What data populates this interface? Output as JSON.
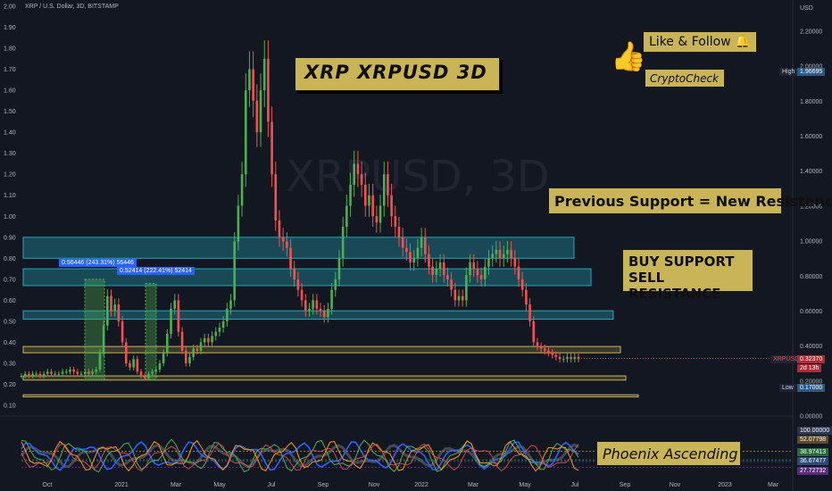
{
  "header": {
    "symbol_text": "XRP / U.S. Dollar, 3D, BITSTAMP"
  },
  "watermark": {
    "text": "XRPUSD, 3D",
    "subtext": "XRP / U.S. Dollar"
  },
  "annotations": {
    "title": "XRP   XRPUSD   3D",
    "like_follow": "Like & Follow 🔔",
    "cryptocheck": "CryptoCheck",
    "previous_support": "Previous Support = New Resistance",
    "buy_support": "BUY SUPPORT",
    "sell_resistance": "SELL RESISTANCE",
    "phoenix": "Phoenix Ascending"
  },
  "measure_labels": [
    "0.56446 (243.31%) 56446",
    "0.52414 (222.41%) 52414"
  ],
  "price_tags": {
    "high_label": "High",
    "high_value": "1.96695",
    "symbol": "XRPUSD",
    "last_value": "0.32370",
    "countdown": "2d 13h",
    "low_label": "Low",
    "low_value": "0.17000"
  },
  "osc_tags": [
    "100.00000",
    "52.07798",
    "38.97413",
    "36.67477",
    "27.72732"
  ],
  "colors": {
    "background": "#131722",
    "up": "#26a69a",
    "down": "#ef5350",
    "up_bright": "#4caf50",
    "zone_blue": "#26a6b8",
    "zone_gold": "#c9b458",
    "annotation_bg": "#c9b458"
  },
  "chart_data": {
    "type": "candlestick",
    "title": "XRP / U.S. Dollar, 3D, BITSTAMP",
    "x_tick_labels": [
      "Oct",
      "2021",
      "Mar",
      "May",
      "Jul",
      "Sep",
      "Nov",
      "2022",
      "Mar",
      "May",
      "Jul",
      "Sep",
      "Nov",
      "2023",
      "Mar"
    ],
    "left_axis_ticks": [
      "2.00",
      "1.90",
      "1.80",
      "1.70",
      "1.60",
      "1.50",
      "1.40",
      "1.30",
      "1.20",
      "1.10",
      "1.00",
      "0.90",
      "0.80",
      "0.70",
      "0.60",
      "0.50",
      "0.40",
      "0.30",
      "0.20",
      "0.10"
    ],
    "right_axis_unit": "USD",
    "right_axis_ticks": [
      "2.20000",
      "2.00000",
      "1.80000",
      "1.60000",
      "1.40000",
      "1.20000",
      "1.00000",
      "0.80000",
      "0.60000",
      "0.40000",
      "0.20000",
      "0.00000"
    ],
    "ylim": [
      0.1,
      2.0
    ],
    "high": 1.96695,
    "low": 0.17,
    "last": 0.3237,
    "blue_zones": [
      [
        0.8,
        0.9
      ],
      [
        0.67,
        0.75
      ],
      [
        0.51,
        0.55
      ]
    ],
    "gold_zones": [
      [
        0.35,
        0.38
      ],
      [
        0.22,
        0.24
      ],
      [
        0.14,
        0.15
      ]
    ],
    "series": [
      {
        "name": "XRPUSD",
        "close": [
          0.24,
          0.25,
          0.24,
          0.25,
          0.25,
          0.24,
          0.25,
          0.26,
          0.25,
          0.25,
          0.25,
          0.26,
          0.26,
          0.27,
          0.26,
          0.25,
          0.25,
          0.26,
          0.25,
          0.26,
          0.27,
          0.35,
          0.48,
          0.62,
          0.55,
          0.58,
          0.5,
          0.4,
          0.3,
          0.28,
          0.32,
          0.26,
          0.24,
          0.23,
          0.25,
          0.26,
          0.27,
          0.3,
          0.35,
          0.44,
          0.56,
          0.6,
          0.45,
          0.36,
          0.3,
          0.33,
          0.37,
          0.36,
          0.4,
          0.42,
          0.4,
          0.43,
          0.45,
          0.47,
          0.5,
          0.56,
          0.6,
          0.88,
          1.05,
          1.2,
          1.6,
          1.7,
          1.55,
          1.4,
          1.6,
          1.75,
          1.45,
          1.2,
          0.98,
          0.9,
          0.88,
          0.85,
          0.75,
          0.7,
          0.65,
          0.6,
          0.55,
          0.56,
          0.6,
          0.56,
          0.55,
          0.52,
          0.56,
          0.65,
          0.7,
          0.8,
          0.95,
          1.05,
          1.15,
          1.25,
          1.2,
          1.15,
          1.05,
          1.1,
          1.0,
          0.97,
          1.05,
          1.2,
          1.1,
          1.0,
          0.95,
          0.9,
          0.85,
          0.83,
          0.78,
          0.8,
          0.85,
          0.9,
          0.82,
          0.76,
          0.72,
          0.75,
          0.78,
          0.72,
          0.7,
          0.65,
          0.6,
          0.62,
          0.6,
          0.72,
          0.78,
          0.75,
          0.72,
          0.7,
          0.76,
          0.8,
          0.82,
          0.84,
          0.8,
          0.82,
          0.84,
          0.8,
          0.76,
          0.7,
          0.65,
          0.58,
          0.5,
          0.4,
          0.38,
          0.37,
          0.36,
          0.35,
          0.34,
          0.33,
          0.32,
          0.32,
          0.33,
          0.32,
          0.33,
          0.32
        ]
      }
    ],
    "oscillator": {
      "name": "Phoenix Ascending",
      "levels": [
        100,
        52.07798,
        38.97413,
        36.67477,
        27.72732
      ]
    }
  }
}
